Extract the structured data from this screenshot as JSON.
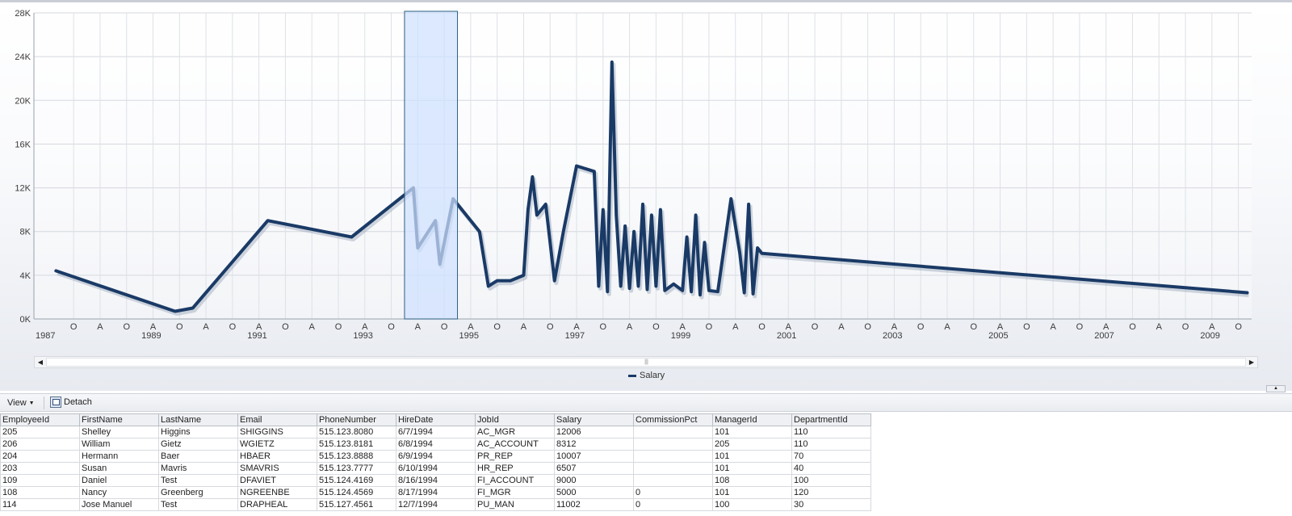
{
  "chart": {
    "y_ticks": [
      "0K",
      "4K",
      "8K",
      "12K",
      "16K",
      "20K",
      "24K",
      "28K"
    ],
    "x_years": [
      "1987",
      "1989",
      "1991",
      "1993",
      "1995",
      "1997",
      "1999",
      "2001",
      "2003",
      "2005",
      "2007",
      "2009"
    ],
    "x_minor_labels": [
      "O",
      "A"
    ],
    "legend_label": "Salary",
    "series_color": "#1a3a66",
    "selection_color": "#cfe0ff"
  },
  "chart_data": {
    "type": "line",
    "ylim": [
      0,
      28000
    ],
    "series": [
      {
        "name": "Salary",
        "points": [
          [
            "1987-06",
            4400
          ],
          [
            "1989-09",
            700
          ],
          [
            "1990-01",
            1000
          ],
          [
            "1991-06",
            9000
          ],
          [
            "1993-01",
            7500
          ],
          [
            "1994-03",
            12000
          ],
          [
            "1994-04",
            6500
          ],
          [
            "1994-08",
            9000
          ],
          [
            "1994-09",
            5000
          ],
          [
            "1994-12",
            11000
          ],
          [
            "1995-03",
            9500
          ],
          [
            "1995-06",
            8000
          ],
          [
            "1995-08",
            3000
          ],
          [
            "1995-10",
            3500
          ],
          [
            "1996-01",
            3500
          ],
          [
            "1996-04",
            4000
          ],
          [
            "1996-05",
            10000
          ],
          [
            "1996-06",
            13000
          ],
          [
            "1996-07",
            9500
          ],
          [
            "1996-09",
            10500
          ],
          [
            "1996-11",
            3500
          ],
          [
            "1997-01",
            8000
          ],
          [
            "1997-04",
            14000
          ],
          [
            "1997-08",
            13500
          ],
          [
            "1997-09",
            3000
          ],
          [
            "1997-10",
            10000
          ],
          [
            "1997-11",
            2500
          ],
          [
            "1997-12",
            23500
          ],
          [
            "1998-01",
            9500
          ],
          [
            "1998-02",
            3000
          ],
          [
            "1998-03",
            8500
          ],
          [
            "1998-04",
            2800
          ],
          [
            "1998-05",
            8000
          ],
          [
            "1998-06",
            3000
          ],
          [
            "1998-07",
            10500
          ],
          [
            "1998-08",
            2700
          ],
          [
            "1998-09",
            9500
          ],
          [
            "1998-10",
            3000
          ],
          [
            "1998-11",
            10000
          ],
          [
            "1998-12",
            2600
          ],
          [
            "1999-02",
            3200
          ],
          [
            "1999-04",
            2600
          ],
          [
            "1999-05",
            7500
          ],
          [
            "1999-06",
            2500
          ],
          [
            "1999-07",
            9500
          ],
          [
            "1999-08",
            2200
          ],
          [
            "1999-09",
            7000
          ],
          [
            "1999-10",
            2600
          ],
          [
            "1999-12",
            2500
          ],
          [
            "2000-03",
            11000
          ],
          [
            "2000-05",
            6000
          ],
          [
            "2000-06",
            2400
          ],
          [
            "2000-07",
            10500
          ],
          [
            "2000-08",
            2300
          ],
          [
            "2000-09",
            6500
          ],
          [
            "2000-10",
            6000
          ],
          [
            "2009-12",
            2400
          ]
        ]
      }
    ],
    "selection_range": [
      "1994-01",
      "1995-01"
    ]
  },
  "toolbar": {
    "view_label": "View",
    "detach_label": "Detach"
  },
  "table": {
    "columns": [
      "EmployeeId",
      "FirstName",
      "LastName",
      "Email",
      "PhoneNumber",
      "HireDate",
      "JobId",
      "Salary",
      "CommissionPct",
      "ManagerId",
      "DepartmentId"
    ],
    "rows": [
      [
        "205",
        "Shelley",
        "Higgins",
        "SHIGGINS",
        "515.123.8080",
        "6/7/1994",
        "AC_MGR",
        "12006",
        "",
        "101",
        "110"
      ],
      [
        "206",
        "William",
        "Gietz",
        "WGIETZ",
        "515.123.8181",
        "6/8/1994",
        "AC_ACCOUNT",
        "8312",
        "",
        "205",
        "110"
      ],
      [
        "204",
        "Hermann",
        "Baer",
        "HBAER",
        "515.123.8888",
        "6/9/1994",
        "PR_REP",
        "10007",
        "",
        "101",
        "70"
      ],
      [
        "203",
        "Susan",
        "Mavris",
        "SMAVRIS",
        "515.123.7777",
        "6/10/1994",
        "HR_REP",
        "6507",
        "",
        "101",
        "40"
      ],
      [
        "109",
        "Daniel",
        "Test",
        "DFAVIET",
        "515.124.4169",
        "8/16/1994",
        "FI_ACCOUNT",
        "9000",
        "",
        "108",
        "100"
      ],
      [
        "108",
        "Nancy",
        "Greenberg",
        "NGREENBE",
        "515.124.4569",
        "8/17/1994",
        "FI_MGR",
        "5000",
        "0",
        "101",
        "120"
      ],
      [
        "114",
        "Jose Manuel",
        "Test",
        "DRAPHEAL",
        "515.127.4561",
        "12/7/1994",
        "PU_MAN",
        "11002",
        "0",
        "100",
        "30"
      ]
    ]
  }
}
